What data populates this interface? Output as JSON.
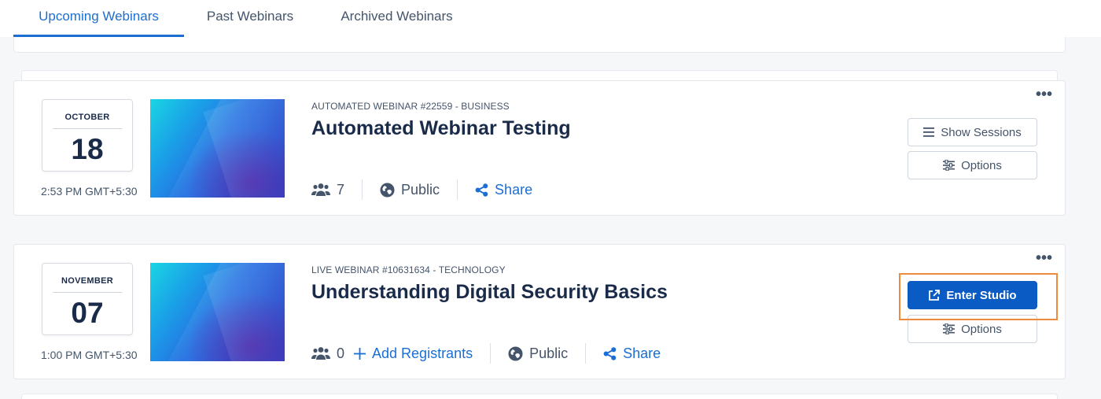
{
  "tabs": [
    {
      "label": "Upcoming Webinars",
      "active": true
    },
    {
      "label": "Past Webinars",
      "active": false
    },
    {
      "label": "Archived Webinars",
      "active": false
    }
  ],
  "webinars": [
    {
      "month": "OCTOBER",
      "day": "18",
      "time": "2:53 PM GMT+5:30",
      "eyebrow": "AUTOMATED WEBINAR #22559 - BUSINESS",
      "title": "Automated Webinar Testing",
      "attendees": "7",
      "visibility": "Public",
      "share_label": "Share",
      "actions": {
        "primary": "Show Sessions",
        "secondary": "Options"
      }
    },
    {
      "month": "NOVEMBER",
      "day": "07",
      "time": "1:00 PM GMT+5:30",
      "eyebrow": "LIVE WEBINAR #10631634 - TECHNOLOGY",
      "title": "Understanding Digital Security Basics",
      "attendees": "0",
      "add_registrants_label": "Add Registrants",
      "visibility": "Public",
      "share_label": "Share",
      "actions": {
        "primary": "Enter Studio",
        "secondary": "Options"
      }
    }
  ],
  "more_label": "•••",
  "colors": {
    "accent": "#1b6ed3",
    "primary_button": "#0b5bc4",
    "highlight": "#ef8a3b"
  }
}
